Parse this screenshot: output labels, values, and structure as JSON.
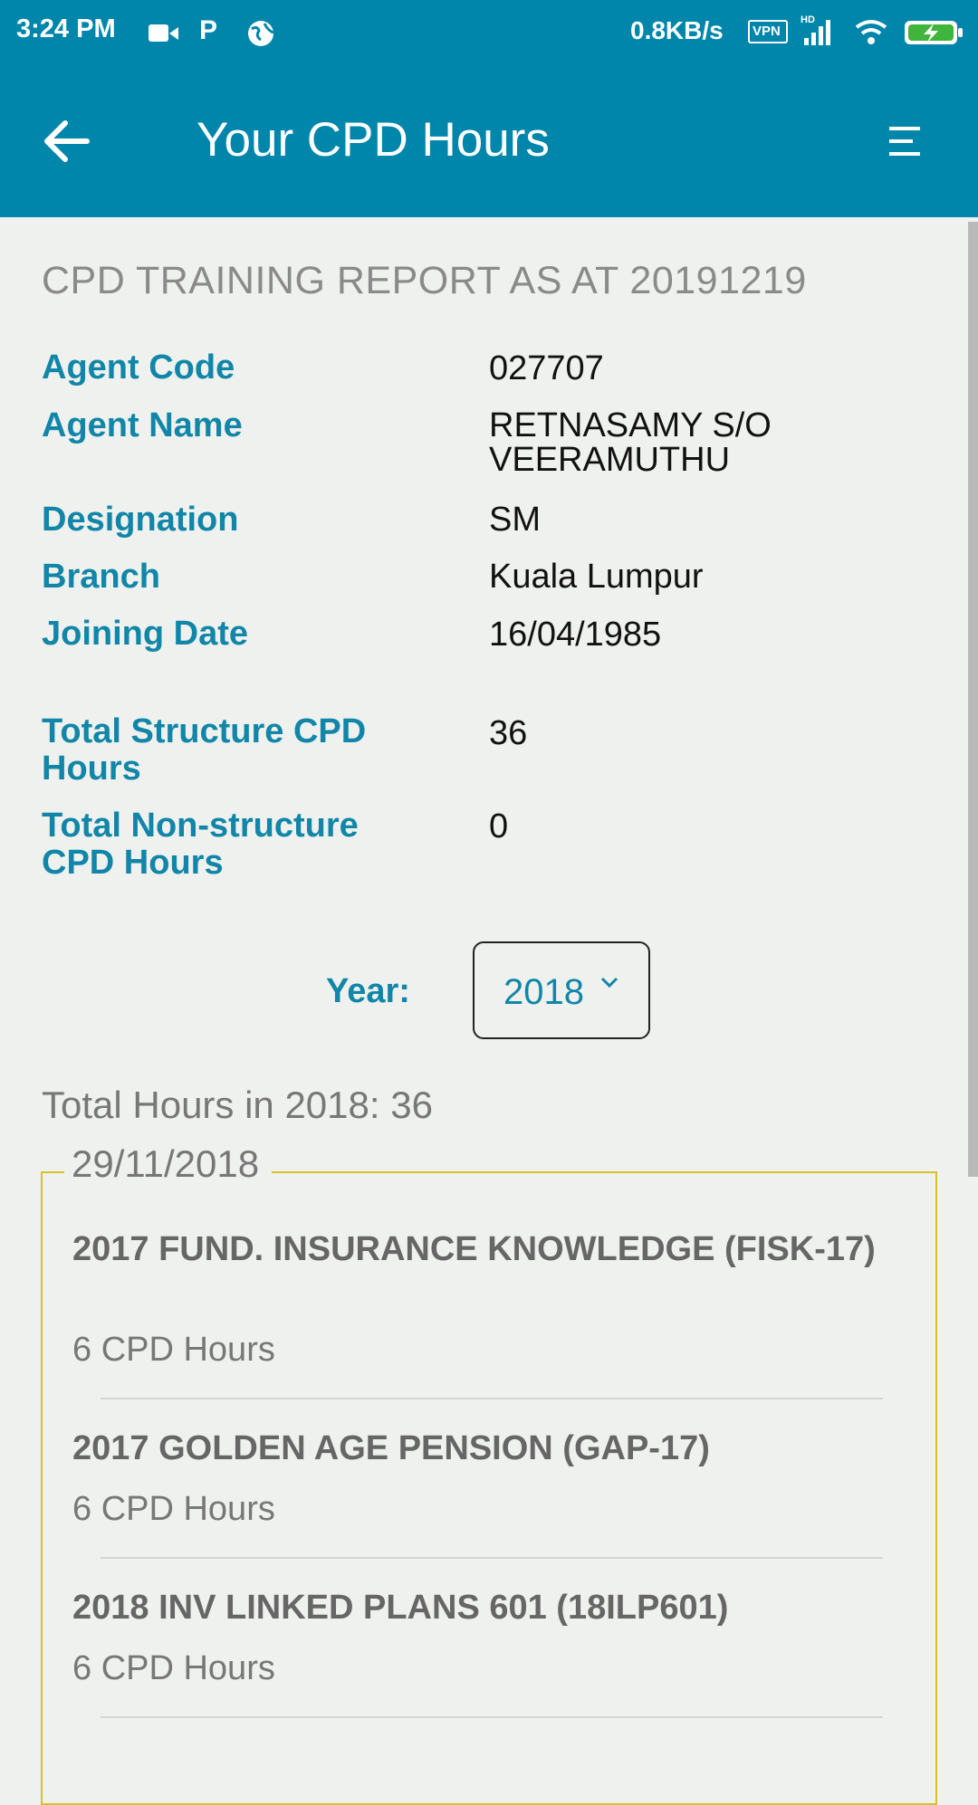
{
  "status_bar": {
    "time": "3:24 PM",
    "speed": "0.8KB/s",
    "vpn": "VPN",
    "hd": "HD"
  },
  "header": {
    "title": "Your CPD Hours",
    "back_icon": "arrow-left-icon",
    "menu_icon": "menu-icon",
    "color": "#0086ab"
  },
  "report": {
    "title": "CPD TRAINING REPORT AS AT 20191219",
    "fields": [
      {
        "label": "Agent Code",
        "value": "027707"
      },
      {
        "label": "Agent Name",
        "value": "RETNASAMY S/O VEERAMUTHU"
      },
      {
        "label": "Designation",
        "value": "SM"
      },
      {
        "label": "Branch",
        "value": "Kuala Lumpur"
      },
      {
        "label": "Joining Date",
        "value": "16/04/1985"
      }
    ],
    "totals": [
      {
        "label": "Total Structure CPD Hours",
        "value": "36"
      },
      {
        "label": "Total Non-structure CPD Hours",
        "value": "0"
      }
    ]
  },
  "year_filter": {
    "label": "Year:",
    "selected": "2018"
  },
  "total_hours": "Total Hours in 2018: 36",
  "group": {
    "date": "29/11/2018",
    "courses": [
      {
        "title": "2017 FUND. INSURANCE KNOWLEDGE (FISK-17)",
        "hours": "6 CPD Hours"
      },
      {
        "title": "2017 GOLDEN AGE PENSION (GAP-17)",
        "hours": "6 CPD Hours"
      },
      {
        "title": "2018 INV LINKED PLANS 601 (18ILP601)",
        "hours": "6 CPD Hours"
      }
    ]
  },
  "colors": {
    "accent": "#1186a8",
    "fieldset_border": "#d8c22a",
    "background": "#eff1ee"
  }
}
